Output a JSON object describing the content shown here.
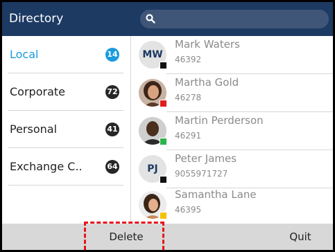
{
  "header": {
    "title": "Directory",
    "search_placeholder": ""
  },
  "categories": [
    {
      "label": "Local",
      "count": "14",
      "active": true
    },
    {
      "label": "Corporate",
      "count": "72",
      "active": false
    },
    {
      "label": "Personal",
      "count": "41",
      "active": false
    },
    {
      "label": "Exchange C..",
      "count": "64",
      "active": false
    }
  ],
  "contacts": [
    {
      "name": "Mark Waters",
      "number": "46392",
      "initials": "MW",
      "presence_color": "#111111"
    },
    {
      "name": "Martha Gold",
      "number": "46278",
      "initials": "",
      "presence_color": "#e11d1d"
    },
    {
      "name": "Martin Perderson",
      "number": "46291",
      "initials": "",
      "presence_color": "#2eb24a"
    },
    {
      "name": "Peter James",
      "number": "9055971727",
      "initials": "PJ",
      "presence_color": "#111111"
    },
    {
      "name": "Samantha Lane",
      "number": "46395",
      "initials": "",
      "presence_color": "#f2c200"
    }
  ],
  "softkeys": {
    "delete": "Delete",
    "quit": "Quit"
  },
  "colors": {
    "header_bg": "#1d3a63",
    "accent": "#1a9ae0",
    "highlight": "#e8141b"
  }
}
